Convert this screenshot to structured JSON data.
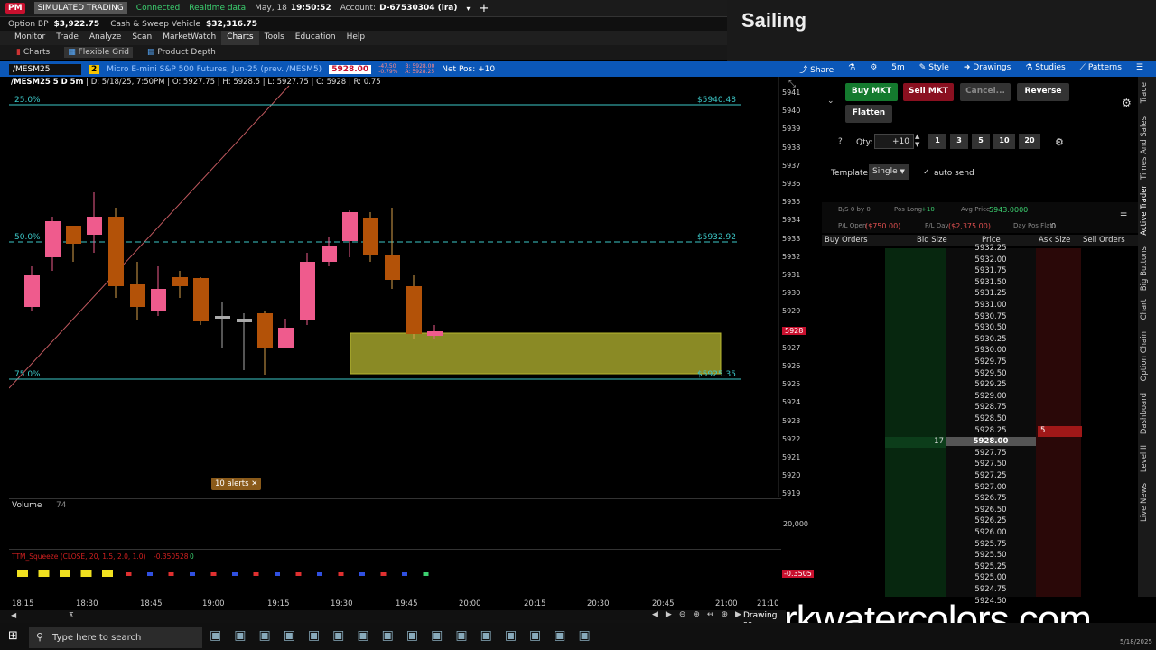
{
  "topbar": {
    "pm": "PM",
    "mode": "SIMULATED TRADING",
    "connected": "Connected",
    "realtime": "Realtime data",
    "date": "May, 18",
    "time": "19:50:52",
    "account_label": "Account:",
    "account": "D-67530304 (ira)"
  },
  "balances": {
    "option_bp_label": "Option BP",
    "option_bp": "$3,922.75",
    "cash_label": "Cash & Sweep Vehicle",
    "cash": "$32,316.75"
  },
  "menu": [
    "Monitor",
    "Trade",
    "Analyze",
    "Scan",
    "MarketWatch",
    "Charts",
    "Tools",
    "Education",
    "Help"
  ],
  "subtabs": [
    "Charts",
    "Flexible Grid",
    "Product Depth"
  ],
  "sailing": "Sailing",
  "symbar": {
    "symbol": "/MESM25",
    "link": "2",
    "description": "Micro E-mini S&P 500 Futures, Jun-25 (prev. /MESM5)",
    "price": "5928.00",
    "change": "-47.50",
    "pct": "-0.79%",
    "bid": "B: 5928.00",
    "ask": "A: 5928.25",
    "netpos": "Net Pos: +10",
    "share": "Share",
    "interval": "5m",
    "style": "Style",
    "drawings": "Drawings",
    "studies": "Studies",
    "patterns": "Patterns"
  },
  "ohlc": {
    "title": "/MESM25 5 D 5m",
    "d": "D: 5/18/25, 7:50PM",
    "o": "O: 5927.75",
    "h": "H: 5928.5",
    "l": "L: 5927.75",
    "c": "C: 5928",
    "r": "R: 0.75"
  },
  "fib": {
    "l25": "25.0%",
    "v25": "$5940.48",
    "l50": "50.0%",
    "v50": "$5932.92",
    "l75": "75.0%",
    "v75": "$5925.35"
  },
  "price_axis": [
    "5941",
    "5940",
    "5939",
    "5938",
    "5937",
    "5936",
    "5935",
    "5934",
    "5933",
    "5932",
    "5931",
    "5930",
    "5929",
    "5928",
    "5927",
    "5926",
    "5925",
    "5924",
    "5923",
    "5922",
    "5921",
    "5920",
    "5919"
  ],
  "current_price_tag": "5928",
  "alerts": "10 alerts",
  "volume": {
    "label": "Volume",
    "value": "74",
    "axis": "20,000"
  },
  "ttm": {
    "label": "TTM_Squeeze (CLOSE, 20, 1.5, 2.0, 1.0)",
    "val": "-0.350528",
    "zero": "0",
    "axis": "-0.3505"
  },
  "time_axis": [
    "18:15",
    "18:30",
    "18:45",
    "19:00",
    "19:15",
    "19:30",
    "19:45",
    "20:00",
    "20:15",
    "20:30",
    "20:45",
    "21:00",
    "21:10"
  ],
  "status_right": "Drawing se",
  "taskbar": {
    "search": "Type here to search",
    "date": "5/18/2025"
  },
  "active_trader": {
    "buy": "Buy MKT",
    "sell": "Sell MKT",
    "cancel": "Cancel...",
    "reverse": "Reverse",
    "flatten": "Flatten",
    "qty_label": "Qty:",
    "qty": "+10",
    "qty_presets": [
      "1",
      "3",
      "5",
      "10",
      "20"
    ],
    "template_label": "Template:",
    "template": "Single",
    "autosend": "auto send",
    "bs": "B/S 0 by 0",
    "pos_long": "Pos Long",
    "pos_long_v": "+10",
    "avg_price": "Avg Price",
    "avg_price_v": "5943.0000",
    "pl_open": "P/L Open",
    "pl_open_v": "($750.00)",
    "pl_day": "P/L Day",
    "pl_day_v": "($2,375.00)",
    "day_pos_flat": "Day Pos Flat",
    "day_pos_flat_v": "0",
    "headers": [
      "Buy Orders",
      "Bid Size",
      "Price",
      "Ask Size",
      "Sell Orders"
    ],
    "ladder": [
      "5932.25",
      "5932.00",
      "5931.75",
      "5931.50",
      "5931.25",
      "5931.00",
      "5930.75",
      "5930.50",
      "5930.25",
      "5930.00",
      "5929.75",
      "5929.50",
      "5929.25",
      "5929.00",
      "5928.75",
      "5928.50",
      "5928.25",
      "5928.00",
      "5927.75",
      "5927.50",
      "5927.25",
      "5927.00",
      "5926.75",
      "5926.50",
      "5926.25",
      "5926.00",
      "5925.75",
      "5925.50",
      "5925.25",
      "5925.00",
      "5924.75",
      "5924.50"
    ],
    "ask_size_row": "5",
    "bid_size_row": "17"
  },
  "sidetabs": [
    "Trade",
    "Times And Sales",
    "Active Trader",
    "Big Buttons",
    "Chart",
    "Option Chain",
    "Dashboard",
    "Level II",
    "Live News"
  ],
  "watermark": "rkwatercolors.com"
}
